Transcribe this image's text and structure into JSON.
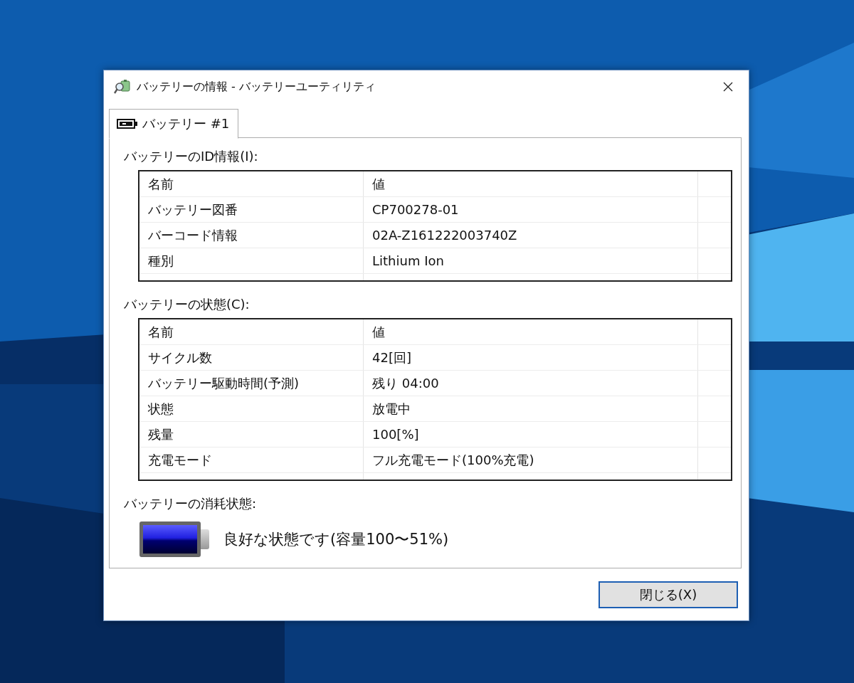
{
  "window": {
    "title": "バッテリーの情報 - バッテリーユーティリティ"
  },
  "tabs": [
    {
      "label": "バッテリー #1",
      "selected": true
    }
  ],
  "id_group": {
    "label": "バッテリーのID情報(I):",
    "columns": [
      "名前",
      "値"
    ],
    "rows": [
      {
        "name": "バッテリー図番",
        "value": "CP700278-01"
      },
      {
        "name": "バーコード情報",
        "value": "02A-Z161222003740Z"
      },
      {
        "name": "種別",
        "value": "Lithium Ion"
      }
    ]
  },
  "status_group": {
    "label": "バッテリーの状態(C):",
    "columns": [
      "名前",
      "値"
    ],
    "rows": [
      {
        "name": "サイクル数",
        "value": "42[回]"
      },
      {
        "name": "バッテリー駆動時間(予測)",
        "value": "残り 04:00"
      },
      {
        "name": "状態",
        "value": "放電中"
      },
      {
        "name": "残量",
        "value": "100[%]"
      },
      {
        "name": "充電モード",
        "value": "フル充電モード(100%充電)"
      }
    ]
  },
  "health": {
    "label": "バッテリーの消耗状態:",
    "level": 1,
    "text": "良好な状態です(容量100〜51%)"
  },
  "buttons": [
    "閉じる(X)"
  ]
}
